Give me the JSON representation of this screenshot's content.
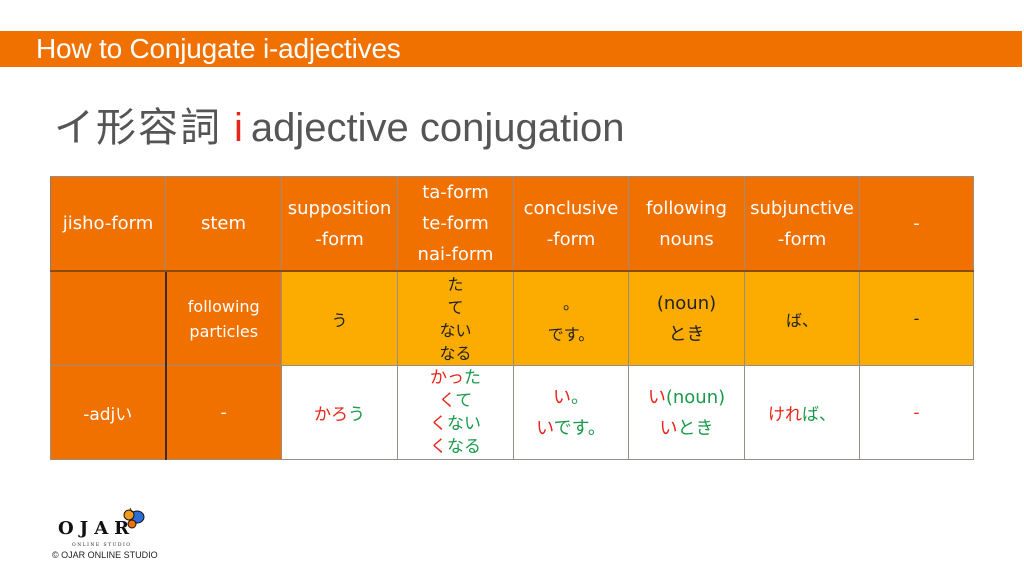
{
  "banner": {
    "title": "How to Conjugate i-adjectives"
  },
  "heading": {
    "japanese": "イ形容詞",
    "highlight": "i",
    "english": "adjective conjugation"
  },
  "colors": {
    "banner": "#f07000",
    "header_cell": "#f07000",
    "ending_row": "#fcac00",
    "stem_red": "#e8251a",
    "suffix_green": "#1a9a4a"
  },
  "table": {
    "headers": [
      "jisho-form",
      "stem",
      "supposition\n-form",
      "ta-form\nte-form\nnai-form",
      "conclusive\n-form",
      "following\nnouns",
      "subjunctive\n-form",
      "-"
    ],
    "endings_row": {
      "label": "",
      "stem": "following\nparticles",
      "supposition": "う",
      "ta_te_nai": [
        "た",
        "て",
        "ない",
        "なる"
      ],
      "conclusive": [
        "。",
        "です。"
      ],
      "following_nouns": [
        "(noun)",
        "とき"
      ],
      "subjunctive": "ば、",
      "dash": "-"
    },
    "adj_row": {
      "label": "-adjい",
      "stem": "-",
      "supposition": {
        "red": "かろ",
        "green": "う"
      },
      "ta_te_nai": [
        {
          "red": "かっ",
          "green": "た"
        },
        {
          "red": "く",
          "green": "て"
        },
        {
          "red": "く",
          "green": "ない"
        },
        {
          "red": "く",
          "green": "なる"
        }
      ],
      "conclusive": [
        {
          "red": "い",
          "green": "。"
        },
        {
          "red": "い",
          "green": "です。"
        }
      ],
      "following_nouns": [
        {
          "red": "い",
          "green": "(noun)"
        },
        {
          "red": "い",
          "green": "とき"
        }
      ],
      "subjunctive": {
        "red": "けれ",
        "green": "ば、"
      },
      "dash": "-"
    }
  },
  "footer": {
    "logo_text": "OJAR",
    "logo_subtext": "ONLINE STUDIO",
    "copyright": "© OJAR ONLINE STUDIO",
    "logo_icon": "butterfly-icon"
  }
}
